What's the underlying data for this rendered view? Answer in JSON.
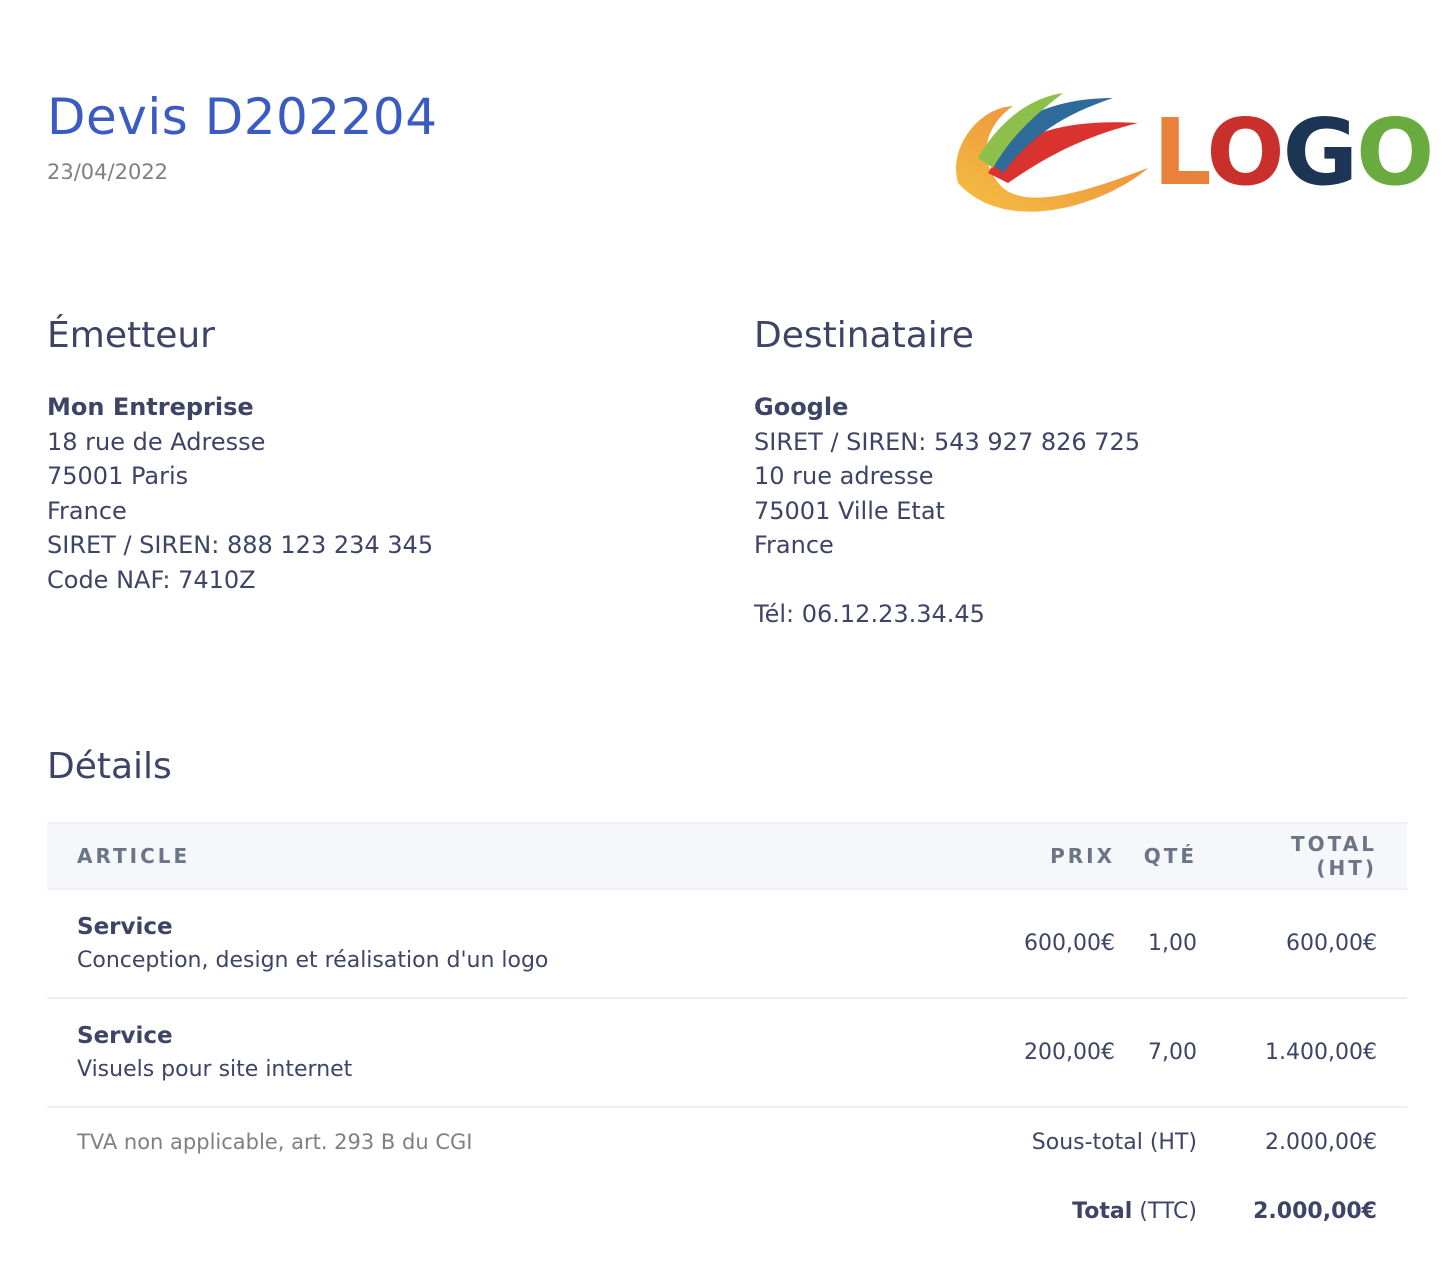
{
  "document": {
    "title": "Devis D202204",
    "date": "23/04/2022",
    "logo_text": "LOGO"
  },
  "sender": {
    "heading": "Émetteur",
    "name": "Mon Entreprise",
    "lines": [
      "18 rue de Adresse",
      "75001 Paris",
      "France",
      "SIRET / SIREN: 888 123 234 345",
      "Code NAF: 7410Z"
    ]
  },
  "recipient": {
    "heading": "Destinataire",
    "name": "Google",
    "lines": [
      "SIRET / SIREN: 543 927 826 725",
      "10 rue adresse",
      "75001 Ville Etat",
      "France"
    ],
    "phone": "Tél: 06.12.23.34.45"
  },
  "details": {
    "heading": "Détails",
    "columns": {
      "article": "ARTICLE",
      "price": "PRIX",
      "qty": "QTÉ",
      "total": "TOTAL (HT)"
    },
    "items": [
      {
        "title": "Service",
        "description": "Conception, design et réalisation d'un logo",
        "price": "600,00€",
        "qty": "1,00",
        "total": "600,00€"
      },
      {
        "title": "Service",
        "description": "Visuels pour site internet",
        "price": "200,00€",
        "qty": "7,00",
        "total": "1.400,00€"
      }
    ],
    "vat_note": "TVA non applicable, art. 293 B du CGI",
    "subtotal_label": "Sous-total (HT)",
    "subtotal_value": "2.000,00€",
    "total_label_bold": "Total",
    "total_label_rest": " (TTC)",
    "total_value": "2.000,00€"
  },
  "colors": {
    "title_blue": "#3b5bc4",
    "text": "#3d4466",
    "muted": "#808080",
    "header_bg": "#f5f7fb"
  }
}
